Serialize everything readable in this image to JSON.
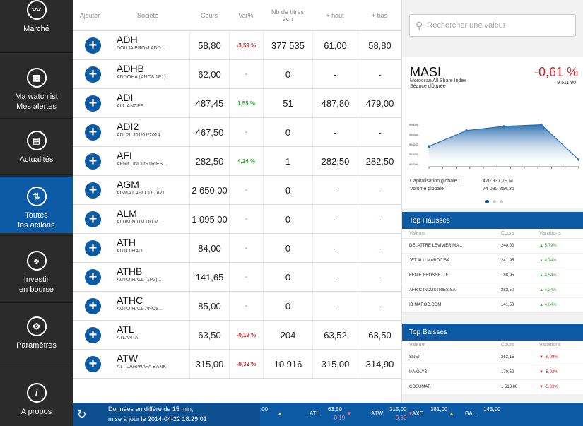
{
  "sidebar": {
    "items": [
      {
        "label1": "Marché",
        "label2": "",
        "icon": "chart-line-icon",
        "glyph": "〰"
      },
      {
        "label1": "Ma watchlist",
        "label2": "Mes alertes",
        "icon": "watchlist-icon",
        "glyph": "▦"
      },
      {
        "label1": "Actualités",
        "label2": "",
        "icon": "news-icon",
        "glyph": "▤"
      },
      {
        "label1": "Toutes",
        "label2": "les actions",
        "icon": "actions-icon",
        "glyph": "⇅"
      },
      {
        "label1": "Investir",
        "label2": "en bourse",
        "icon": "tree-icon",
        "glyph": "♣"
      },
      {
        "label1": "Paramètres",
        "label2": "",
        "icon": "settings-icon",
        "glyph": "⚙"
      },
      {
        "label1": "A propos",
        "label2": "",
        "icon": "info-icon",
        "glyph": "i"
      }
    ]
  },
  "table": {
    "headers": {
      "ajouter": "Ajouter",
      "societe": "Société",
      "cours": "Cours",
      "var": "Var%",
      "nb1": "Nb de titres",
      "nb2": "éch",
      "haut": "+ haut",
      "bas": "+ bas"
    },
    "rows": [
      {
        "ticker": "ADH",
        "name": "DOUJA PROM ADD...",
        "cours": "58,80",
        "var": "-3,59 %",
        "dir": "down",
        "nb": "377 535",
        "haut": "61,00",
        "bas": "58,80"
      },
      {
        "ticker": "ADHB",
        "name": "ADDOHA (ANO8 1P1)",
        "cours": "62,00",
        "var": "-",
        "dir": "none",
        "nb": "0",
        "haut": "-",
        "bas": "-"
      },
      {
        "ticker": "ADI",
        "name": "ALLIANCES",
        "cours": "487,45",
        "var": "1,55 %",
        "dir": "up",
        "nb": "51",
        "haut": "487,80",
        "bas": "479,00"
      },
      {
        "ticker": "ADI2",
        "name": "ADI 2L J01/01/2014",
        "cours": "467,50",
        "var": "-",
        "dir": "none",
        "nb": "0",
        "haut": "-",
        "bas": "-"
      },
      {
        "ticker": "AFI",
        "name": "AFRIC INDUSTRIES...",
        "cours": "282,50",
        "var": "4,24 %",
        "dir": "up",
        "nb": "1",
        "haut": "282,50",
        "bas": "282,50"
      },
      {
        "ticker": "AGM",
        "name": "AGMA LAHLOU-TAZI",
        "cours": "2 650,00",
        "var": "-",
        "dir": "none",
        "nb": "0",
        "haut": "-",
        "bas": "-"
      },
      {
        "ticker": "ALM",
        "name": "ALUMINIUM DU M...",
        "cours": "1 095,00",
        "var": "-",
        "dir": "none",
        "nb": "0",
        "haut": "-",
        "bas": "-"
      },
      {
        "ticker": "ATH",
        "name": "AUTO HALL",
        "cours": "84,00",
        "var": "-",
        "dir": "none",
        "nb": "0",
        "haut": "-",
        "bas": "-"
      },
      {
        "ticker": "ATHB",
        "name": "AUTO HALL (1P2)...",
        "cours": "141,65",
        "var": "-",
        "dir": "none",
        "nb": "0",
        "haut": "-",
        "bas": "-"
      },
      {
        "ticker": "ATHC",
        "name": "AUTO HALL ANO8...",
        "cours": "85,00",
        "var": "-",
        "dir": "none",
        "nb": "0",
        "haut": "-",
        "bas": "-"
      },
      {
        "ticker": "ATL",
        "name": "ATLANTA",
        "cours": "63,50",
        "var": "-0,19 %",
        "dir": "down",
        "nb": "204",
        "haut": "63,52",
        "bas": "63,50"
      },
      {
        "ticker": "ATW",
        "name": "ATTIJARIWAFA BANK",
        "cours": "315,00",
        "var": "-0,32 %",
        "dir": "down",
        "nb": "10 916",
        "haut": "315,00",
        "bas": "314,90"
      }
    ]
  },
  "search": {
    "placeholder": "Rechercher une valeur"
  },
  "masi": {
    "title": "MASI",
    "subtitle": "Moroccan All Share Index",
    "status": "Séance clôturée",
    "variation": "-0,61 %",
    "value": "9 511,90",
    "cap_label": "Capitalisation globale :",
    "cap_value": "470 937,79 M",
    "vol_label": "Volume globale:",
    "vol_value": "74 080 254,36",
    "ticks": [
      "9560,0 -",
      "9550,0 -",
      "9540,0 -",
      "9530,0 -",
      "9520,0 -"
    ]
  },
  "chart_data": {
    "type": "area",
    "x": [
      1,
      2,
      3,
      4,
      5
    ],
    "values": [
      9536,
      9555,
      9560,
      9562,
      9520
    ],
    "ylim": [
      9515,
      9565
    ],
    "accent": "#0b5aa3"
  },
  "top_hausses": {
    "title": "Top Hausses",
    "cols": {
      "valeurs": "Valeurs",
      "cours": "Cours",
      "variations": "Variations"
    },
    "rows": [
      {
        "name": "DELATTRE LEVIVIER MA...",
        "cours": "240,00",
        "var": "▲  5,79%"
      },
      {
        "name": "JET ALU MAROC SA",
        "cours": "241,95",
        "var": "▲  4,74%"
      },
      {
        "name": "FENIE BROSSETTE",
        "cours": "188,95",
        "var": "▲  4,54%"
      },
      {
        "name": "AFRIC INDUSTRIES SA",
        "cours": "282,50",
        "var": "▲  4,24%"
      },
      {
        "name": "IB MAROC.COM",
        "cours": "141,50",
        "var": "▲  4,04%"
      }
    ]
  },
  "top_baisses": {
    "title": "Top Baisses",
    "cols": {
      "valeurs": "Valeurs",
      "cours": "Cours",
      "variations": "Variations"
    },
    "rows": [
      {
        "name": "SNEP",
        "cours": "363,15",
        "var": "▼  -6,09%"
      },
      {
        "name": "INVOLYS",
        "cours": "170,50",
        "var": "▼  -5,92%"
      },
      {
        "name": "COSUMAR",
        "cours": "1 613,00",
        "var": "▼  -5,03%"
      }
    ]
  },
  "footer": {
    "delay_line1": "Données en différé de 15 min,",
    "delay_line2": "mise à jour le 2014-04-22 18:29:01",
    "tickers": [
      {
        "name": "",
        "price": ",00",
        "chg": "",
        "arrow": "▲"
      },
      {
        "name": "ATL",
        "price": "63,50",
        "chg": "-0,19",
        "arrow": "▼"
      },
      {
        "name": "ATW",
        "price": "315,00",
        "chg": "-0,32",
        "arrow": "▼"
      },
      {
        "name": "AXC",
        "price": "381,00",
        "chg": "",
        "arrow": "▲"
      },
      {
        "name": "BAL",
        "price": "143,00",
        "chg": "",
        "arrow": ""
      }
    ]
  }
}
